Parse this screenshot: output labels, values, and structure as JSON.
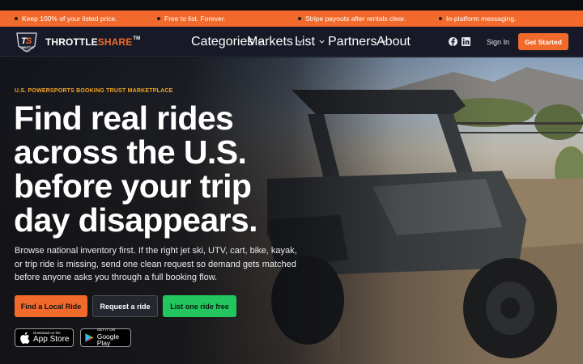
{
  "promo": {
    "items": [
      {
        "text": "Keep 100% of your listed price."
      },
      {
        "text": "Free to list. Forever."
      },
      {
        "text": "Stripe payouts after rentals clear."
      },
      {
        "text": "In-platform messaging."
      }
    ]
  },
  "nav": {
    "brand_logo_text": "TS THROTTLE SHARE",
    "brand_part1": "THROTTLE",
    "brand_part2": "SHARE",
    "brand_tm": "TM",
    "menu": [
      {
        "label": "Categories",
        "has_dropdown": true
      },
      {
        "label": "Markets",
        "has_dropdown": true
      },
      {
        "label": "List",
        "has_dropdown": true
      },
      {
        "label": "Partners",
        "has_dropdown": true
      },
      {
        "label": "About",
        "has_dropdown": false
      }
    ],
    "social_icons": [
      "facebook-icon",
      "linkedin-icon"
    ],
    "signin_label": "Sign In",
    "cta_label": "Get Started"
  },
  "hero": {
    "eyebrow": "U.S. POWERSPORTS BOOKING TRUST MARKETPLACE",
    "headline_lines": [
      "Find real rides",
      "across the U.S.",
      "before your trip",
      "day disappears."
    ],
    "subcopy": "Browse national inventory first. If the right jet ski, UTV, cart, bike, kayak, or trip ride is missing, send one clean request so demand gets matched before anyone asks you through a full booking flow.",
    "buttons": {
      "find": "Find a Local Ride",
      "request": "Request a ride",
      "list": "List one ride free"
    },
    "app_store": {
      "small": "Download on the",
      "big": "App Store"
    },
    "google_play": {
      "small": "GET IT ON",
      "big": "Google Play"
    }
  },
  "colors": {
    "accent_orange": "#f26a2b",
    "accent_green": "#22c55e",
    "eyebrow_yellow": "#f6a623",
    "nav_bg": "#171a26"
  }
}
